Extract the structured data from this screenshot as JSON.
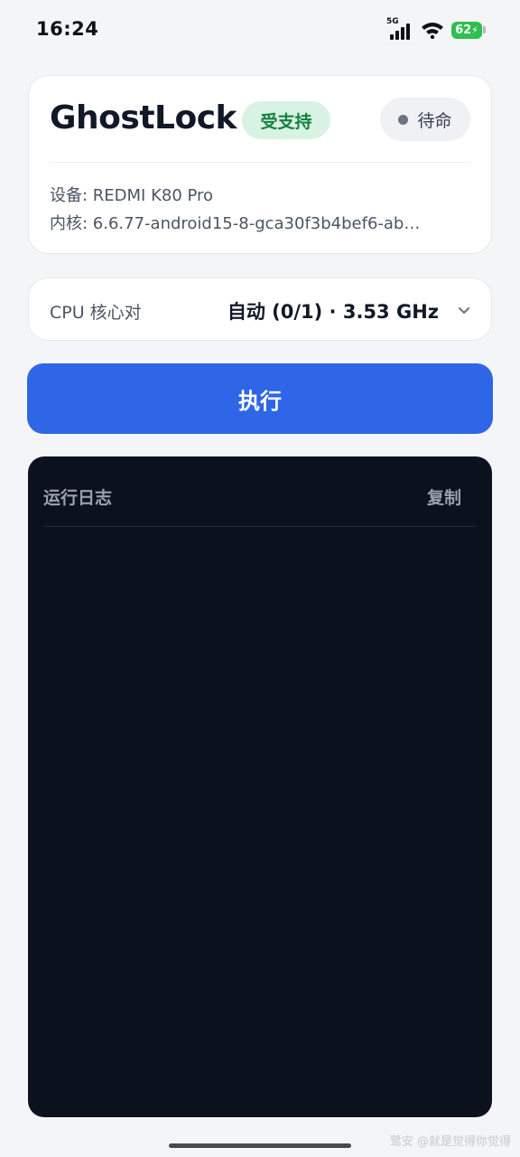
{
  "status_bar": {
    "time": "16:24",
    "network_label": "5G",
    "battery_level": "62"
  },
  "device_card": {
    "app_title": "GhostLock",
    "supported_badge": "受支持",
    "standby_label": "待命",
    "device_line": "设备: REDMI K80 Pro",
    "kernel_line": "内核: 6.6.77-android15-8-gca30f3b4bef6-ab…"
  },
  "cpu_selector": {
    "label": "CPU 核心对",
    "value": "自动 (0/1) · 3.53 GHz"
  },
  "execute_button": {
    "label": "执行"
  },
  "log_panel": {
    "title": "运行日志",
    "copy_label": "复制",
    "entries": []
  },
  "watermark": "鹭安 @就是觉得你觉得",
  "colors": {
    "accent": "#2f66e8",
    "supported_bg": "#d8f3e4",
    "supported_text": "#14803f",
    "log_bg": "#0c1120",
    "battery": "#2fbf4f"
  }
}
